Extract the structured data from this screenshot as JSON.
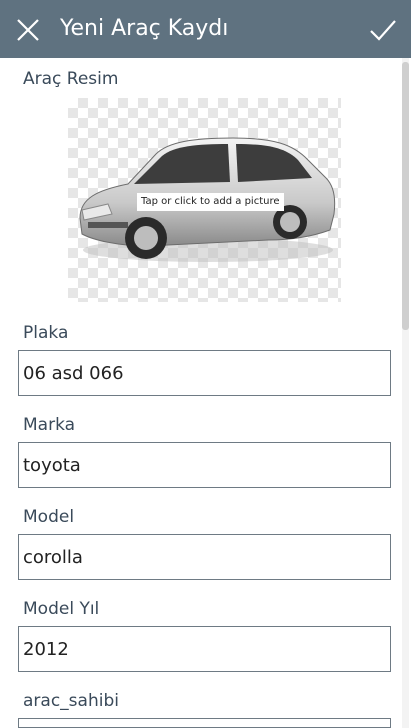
{
  "header": {
    "title": "Yeni Araç Kaydı",
    "close_icon": "close-icon",
    "submit_icon": "checkmark-icon",
    "bg_color": "#5f7280"
  },
  "form": {
    "image": {
      "label": "Araç Resim",
      "hint": "Tap or click to add a picture"
    },
    "plaka": {
      "label": "Plaka",
      "value": "06 asd 066"
    },
    "marka": {
      "label": "Marka",
      "value": "toyota"
    },
    "model": {
      "label": "Model",
      "value": "corolla"
    },
    "model_yil": {
      "label": "Model Yıl",
      "value": "2012"
    },
    "arac_sahibi": {
      "label": "arac_sahibi",
      "value": ""
    }
  }
}
